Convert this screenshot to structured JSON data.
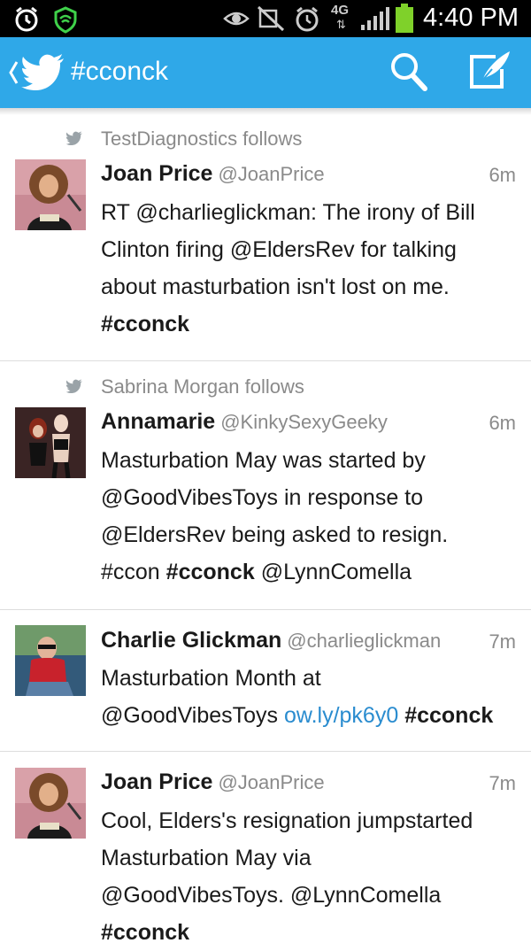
{
  "status_bar": {
    "time": "4:40 PM",
    "network": "4G",
    "icons": [
      "alarm-icon",
      "shield-icon",
      "eye-icon",
      "mute-icon",
      "alarm-clock-icon",
      "signal-icon",
      "battery-icon"
    ]
  },
  "action_bar": {
    "title": "#cconck",
    "icons": [
      "back-icon",
      "twitter-bird-icon",
      "search-icon",
      "compose-icon"
    ]
  },
  "tweets": [
    {
      "follow_note": "TestDiagnostics follows",
      "name": "Joan Price",
      "handle": "@JoanPrice",
      "time": "6m",
      "lines": [
        "RT @charlieglickman: The irony of Bill",
        "Clinton firing @EldersRev for talking",
        "about masturbation isn't lost on me.",
        "#cconck"
      ]
    },
    {
      "follow_note": "Sabrina Morgan follows",
      "name": "Annamarie",
      "handle": "@KinkySexyGeeky",
      "time": "6m",
      "lines": [
        "Masturbation May was started by",
        "@GoodVibesToys in response to",
        "@EldersRev being asked to resign.",
        "#ccon",
        "#cconck",
        "@LynnComella"
      ]
    },
    {
      "name": "Charlie Glickman",
      "handle": "@charlieglickman",
      "time": "7m",
      "lines": [
        "Masturbation Month at",
        "@GoodVibesToys",
        "ow.ly/pk6y0",
        "#cconck"
      ]
    },
    {
      "name": "Joan Price",
      "handle": "@JoanPrice",
      "time": "7m",
      "lines": [
        "Cool, Elders's resignation jumpstarted",
        "Masturbation May via",
        "@GoodVibesToys. @LynnComella",
        "#cconck"
      ]
    }
  ],
  "colors": {
    "accent": "#2fa8e8",
    "link": "#2a8ccf",
    "secondary_text": "#8a8a8a"
  }
}
